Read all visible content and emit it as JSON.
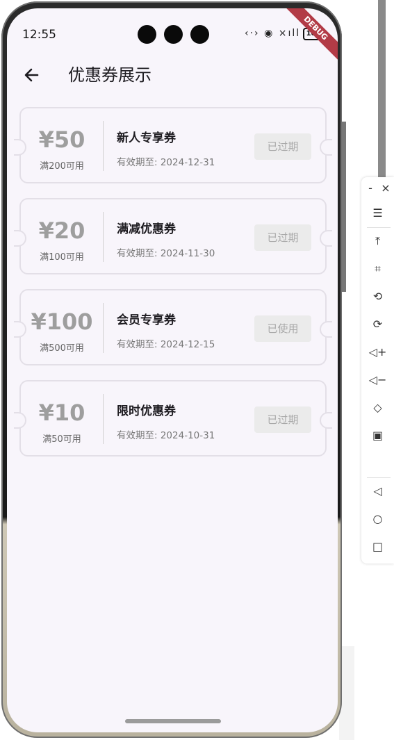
{
  "status": {
    "time": "12:55",
    "battery": "100",
    "debug": "DEBUG",
    "icons": "‹·› ◉ ×ıll"
  },
  "appbar": {
    "title": "优惠券展示"
  },
  "coupons": [
    {
      "amount": "¥50",
      "condition": "满200可用",
      "name": "新人专享券",
      "expire": "有效期至: 2024-12-31",
      "state": "已过期"
    },
    {
      "amount": "¥20",
      "condition": "满100可用",
      "name": "满减优惠券",
      "expire": "有效期至: 2024-11-30",
      "state": "已过期"
    },
    {
      "amount": "¥100",
      "condition": "满500可用",
      "name": "会员专享券",
      "expire": "有效期至: 2024-12-15",
      "state": "已使用"
    },
    {
      "amount": "¥10",
      "condition": "满50可用",
      "name": "限时优惠券",
      "expire": "有效期至: 2024-10-31",
      "state": "已过期"
    }
  ],
  "tools": {
    "minimize": "-",
    "close": "×",
    "menu": "☰",
    "top": "⤒",
    "crop": "⌗",
    "rotate_left": "⟲",
    "rotate_right": "⟳",
    "vol_up": "◁+",
    "vol_down": "◁−",
    "shake": "◇",
    "screenshot": "▣",
    "back": "◁",
    "home": "○",
    "recent": "□"
  }
}
